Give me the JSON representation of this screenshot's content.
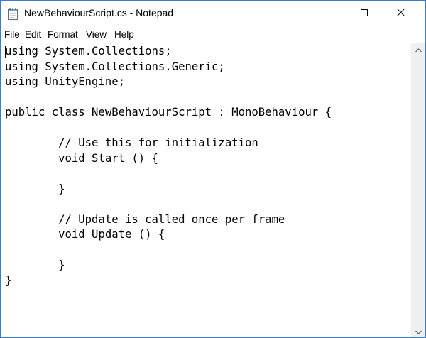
{
  "window": {
    "title": "NewBehaviourScript.cs - Notepad"
  },
  "menu": {
    "file": "File",
    "edit": "Edit",
    "format": "Format",
    "view": "View",
    "help": "Help"
  },
  "editor": {
    "content": "using System.Collections;\nusing System.Collections.Generic;\nusing UnityEngine;\n\npublic class NewBehaviourScript : MonoBehaviour {\n\n\t// Use this for initialization\n\tvoid Start () {\n\t\t\n\t}\n\t\n\t// Update is called once per frame\n\tvoid Update () {\n\t\t\n\t}\n}"
  },
  "icons": {
    "app": "notepad-icon",
    "minimize": "minimize-icon",
    "maximize": "maximize-icon",
    "close": "close-icon"
  },
  "colors": {
    "window_border": "#3a7bd5",
    "scrollbar": "#f0f0f0"
  }
}
